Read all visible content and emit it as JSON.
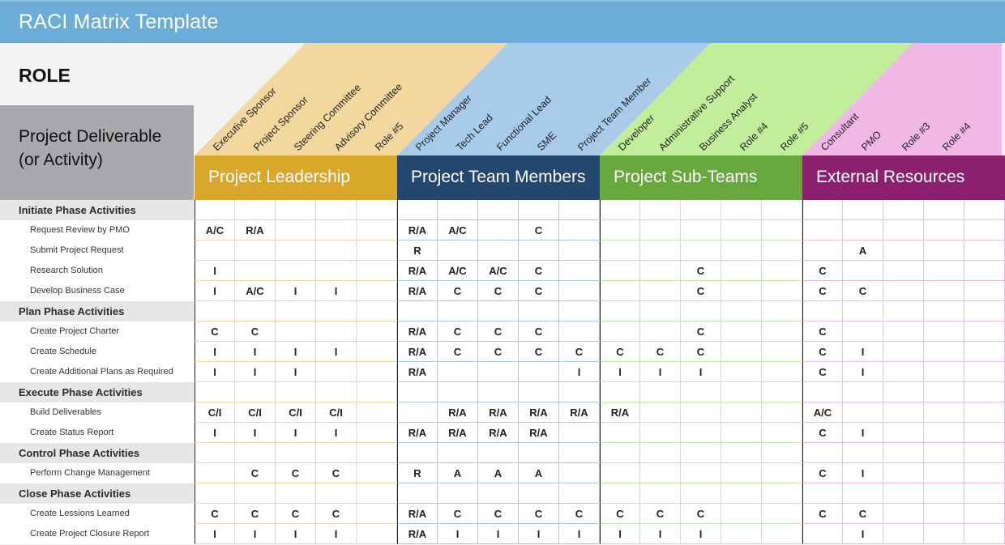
{
  "title": "RACI Matrix Template",
  "role_label": "ROLE",
  "deliverable_label": "Project Deliverable\n(or Activity)",
  "groups": [
    {
      "name": "Project Leadership",
      "band_color": "#f2d89f",
      "bar_color": "#d8a72c",
      "roles": [
        "Executive Sponsor",
        "Project Sponsor",
        "Steering Committee",
        "Advisory Committee",
        "Role #5"
      ]
    },
    {
      "name": "Project Team Members",
      "band_color": "#a8cbea",
      "bar_color": "#24476f",
      "roles": [
        "Project Manager",
        "Tech Lead",
        "Functional Lead",
        "SME",
        "Project Team Member"
      ]
    },
    {
      "name": "Project Sub-Teams",
      "band_color": "#c2ee9c",
      "bar_color": "#69a73f",
      "roles": [
        "Developer",
        "Administrative Support",
        "Business Analyst",
        "Role #4",
        "Role #5"
      ]
    },
    {
      "name": "External Resources",
      "band_color": "#f1b7e5",
      "bar_color": "#8c1f6f",
      "roles": [
        "Consultant",
        "PMO",
        "Role #3",
        "Role #4",
        ""
      ]
    }
  ],
  "rows": [
    {
      "type": "phase",
      "label": "Initiate Phase Activities",
      "values": [
        "",
        "",
        "",
        "",
        "",
        "",
        "",
        "",
        "",
        "",
        "",
        "",
        "",
        "",
        "",
        "",
        "",
        "",
        "",
        ""
      ]
    },
    {
      "type": "task",
      "label": "Request Review by PMO",
      "values": [
        "A/C",
        "R/A",
        "",
        "",
        "",
        "R/A",
        "A/C",
        "",
        "C",
        "",
        "",
        "",
        "",
        "",
        "",
        "",
        "",
        "",
        "",
        ""
      ]
    },
    {
      "type": "task",
      "label": "Submit Project Request",
      "values": [
        "",
        "",
        "",
        "",
        "",
        "R",
        "",
        "",
        "",
        "",
        "",
        "",
        "",
        "",
        "",
        "",
        "A",
        "",
        "",
        ""
      ]
    },
    {
      "type": "task",
      "label": "Research Solution",
      "values": [
        "I",
        "",
        "",
        "",
        "",
        "R/A",
        "A/C",
        "A/C",
        "C",
        "",
        "",
        "",
        "C",
        "",
        "",
        "C",
        "",
        "",
        "",
        ""
      ]
    },
    {
      "type": "task",
      "label": "Develop Business Case",
      "values": [
        "I",
        "A/C",
        "I",
        "I",
        "",
        "R/A",
        "C",
        "C",
        "C",
        "",
        "",
        "",
        "C",
        "",
        "",
        "C",
        "C",
        "",
        "",
        ""
      ]
    },
    {
      "type": "phase",
      "label": "Plan Phase Activities",
      "values": [
        "",
        "",
        "",
        "",
        "",
        "",
        "",
        "",
        "",
        "",
        "",
        "",
        "",
        "",
        "",
        "",
        "",
        "",
        "",
        ""
      ]
    },
    {
      "type": "task",
      "label": "Create Project Charter",
      "values": [
        "C",
        "C",
        "",
        "",
        "",
        "R/A",
        "C",
        "C",
        "C",
        "",
        "",
        "",
        "C",
        "",
        "",
        "C",
        "",
        "",
        "",
        ""
      ]
    },
    {
      "type": "task",
      "label": "Create Schedule",
      "values": [
        "I",
        "I",
        "I",
        "I",
        "",
        "R/A",
        "C",
        "C",
        "C",
        "C",
        "C",
        "C",
        "C",
        "",
        "",
        "C",
        "I",
        "",
        "",
        ""
      ]
    },
    {
      "type": "task",
      "label": "Create Additional Plans as Required",
      "values": [
        "I",
        "I",
        "I",
        "",
        "",
        "R/A",
        "",
        "",
        "",
        "I",
        "I",
        "I",
        "I",
        "",
        "",
        "C",
        "I",
        "",
        "",
        ""
      ]
    },
    {
      "type": "phase",
      "label": "Execute Phase Activities",
      "values": [
        "",
        "",
        "",
        "",
        "",
        "",
        "",
        "",
        "",
        "",
        "",
        "",
        "",
        "",
        "",
        "",
        "",
        "",
        "",
        ""
      ]
    },
    {
      "type": "task",
      "label": "Build Deliverables",
      "values": [
        "C/I",
        "C/I",
        "C/I",
        "C/I",
        "",
        "",
        "R/A",
        "R/A",
        "R/A",
        "R/A",
        "R/A",
        "",
        "",
        "",
        "",
        "A/C",
        "",
        "",
        "",
        ""
      ]
    },
    {
      "type": "task",
      "label": "Create Status Report",
      "values": [
        "I",
        "I",
        "I",
        "I",
        "",
        "R/A",
        "R/A",
        "R/A",
        "R/A",
        "",
        "",
        "",
        "",
        "",
        "",
        "C",
        "I",
        "",
        "",
        ""
      ]
    },
    {
      "type": "phase",
      "label": "Control Phase Activities",
      "values": [
        "",
        "",
        "",
        "",
        "",
        "",
        "",
        "",
        "",
        "",
        "",
        "",
        "",
        "",
        "",
        "",
        "",
        "",
        "",
        ""
      ]
    },
    {
      "type": "task",
      "label": "Perform Change Management",
      "values": [
        "",
        "C",
        "C",
        "C",
        "",
        "R",
        "A",
        "A",
        "A",
        "",
        "",
        "",
        "",
        "",
        "",
        "C",
        "I",
        "",
        "",
        ""
      ]
    },
    {
      "type": "phase",
      "label": "Close Phase Activities",
      "values": [
        "",
        "",
        "",
        "",
        "",
        "",
        "",
        "",
        "",
        "",
        "",
        "",
        "",
        "",
        "",
        "",
        "",
        "",
        "",
        ""
      ]
    },
    {
      "type": "task",
      "label": "Create Lessions Learned",
      "values": [
        "C",
        "C",
        "C",
        "C",
        "",
        "R/A",
        "C",
        "C",
        "C",
        "C",
        "C",
        "C",
        "C",
        "",
        "",
        "C",
        "C",
        "",
        "",
        ""
      ]
    },
    {
      "type": "task",
      "label": "Create Project Closure Report",
      "values": [
        "I",
        "I",
        "I",
        "I",
        "",
        "R/A",
        "I",
        "I",
        "I",
        "I",
        "I",
        "I",
        "I",
        "",
        "",
        "",
        "I",
        "",
        "",
        ""
      ]
    }
  ]
}
